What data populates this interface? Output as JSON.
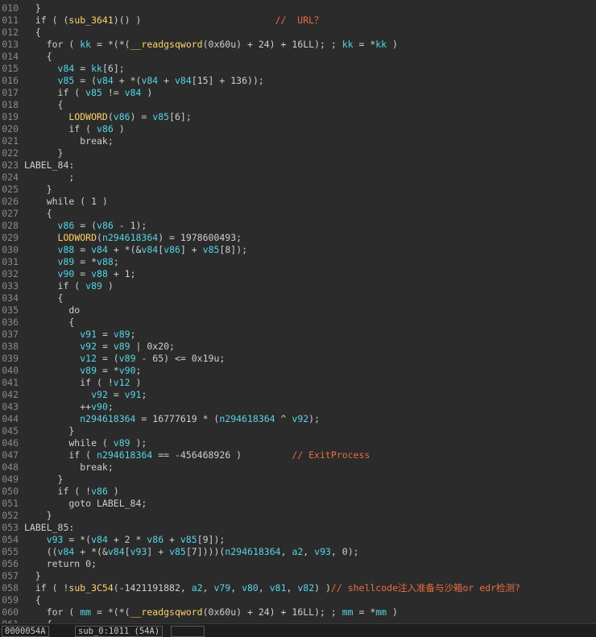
{
  "editor": {
    "lines": [
      {
        "n": "010",
        "tokens": [
          {
            "t": "  }",
            "c": "plain"
          }
        ]
      },
      {
        "n": "011",
        "tokens": [
          {
            "t": "  if ( (",
            "c": "plain"
          },
          {
            "t": "sub_3641",
            "c": "func"
          },
          {
            "t": ")() )                        ",
            "c": "plain"
          },
          {
            "t": "//  URL？",
            "c": "comment"
          }
        ]
      },
      {
        "n": "012",
        "tokens": [
          {
            "t": "  {",
            "c": "plain"
          }
        ]
      },
      {
        "n": "013",
        "tokens": [
          {
            "t": "    for ( ",
            "c": "plain"
          },
          {
            "t": "kk",
            "c": "var"
          },
          {
            "t": " = *(*(",
            "c": "plain"
          },
          {
            "t": "__readgsqword",
            "c": "func"
          },
          {
            "t": "(0x60u) + 24) + 16LL); ; ",
            "c": "plain"
          },
          {
            "t": "kk",
            "c": "var"
          },
          {
            "t": " = *",
            "c": "plain"
          },
          {
            "t": "kk",
            "c": "var"
          },
          {
            "t": " )",
            "c": "plain"
          }
        ]
      },
      {
        "n": "014",
        "tokens": [
          {
            "t": "    {",
            "c": "plain"
          }
        ]
      },
      {
        "n": "015",
        "tokens": [
          {
            "t": "      ",
            "c": "plain"
          },
          {
            "t": "v84",
            "c": "var"
          },
          {
            "t": " = ",
            "c": "plain"
          },
          {
            "t": "kk",
            "c": "var"
          },
          {
            "t": "[6];",
            "c": "plain"
          }
        ]
      },
      {
        "n": "016",
        "tokens": [
          {
            "t": "      ",
            "c": "plain"
          },
          {
            "t": "v85",
            "c": "var"
          },
          {
            "t": " = (",
            "c": "plain"
          },
          {
            "t": "v84",
            "c": "var"
          },
          {
            "t": " + *(",
            "c": "plain"
          },
          {
            "t": "v84",
            "c": "var"
          },
          {
            "t": " + ",
            "c": "plain"
          },
          {
            "t": "v84",
            "c": "var"
          },
          {
            "t": "[15] + 136));",
            "c": "plain"
          }
        ]
      },
      {
        "n": "017",
        "tokens": [
          {
            "t": "      if ( ",
            "c": "plain"
          },
          {
            "t": "v85",
            "c": "var"
          },
          {
            "t": " != ",
            "c": "plain"
          },
          {
            "t": "v84",
            "c": "var"
          },
          {
            "t": " )",
            "c": "plain"
          }
        ]
      },
      {
        "n": "018",
        "tokens": [
          {
            "t": "      {",
            "c": "plain"
          }
        ]
      },
      {
        "n": "019",
        "tokens": [
          {
            "t": "        ",
            "c": "plain"
          },
          {
            "t": "LODWORD",
            "c": "func"
          },
          {
            "t": "(",
            "c": "plain"
          },
          {
            "t": "v86",
            "c": "var"
          },
          {
            "t": ") = ",
            "c": "plain"
          },
          {
            "t": "v85",
            "c": "var"
          },
          {
            "t": "[6];",
            "c": "plain"
          }
        ]
      },
      {
        "n": "020",
        "tokens": [
          {
            "t": "        if ( ",
            "c": "plain"
          },
          {
            "t": "v86",
            "c": "var"
          },
          {
            "t": " )",
            "c": "plain"
          }
        ]
      },
      {
        "n": "021",
        "tokens": [
          {
            "t": "          break;",
            "c": "plain"
          }
        ]
      },
      {
        "n": "022",
        "tokens": [
          {
            "t": "      }",
            "c": "plain"
          }
        ]
      },
      {
        "n": "023",
        "tokens": [
          {
            "t": "LABEL_84:",
            "c": "plain"
          }
        ]
      },
      {
        "n": "024",
        "tokens": [
          {
            "t": "        ;",
            "c": "plain"
          }
        ]
      },
      {
        "n": "025",
        "tokens": [
          {
            "t": "    }",
            "c": "plain"
          }
        ]
      },
      {
        "n": "026",
        "tokens": [
          {
            "t": "    while ( 1 )",
            "c": "plain"
          }
        ]
      },
      {
        "n": "027",
        "tokens": [
          {
            "t": "    {",
            "c": "plain"
          }
        ]
      },
      {
        "n": "028",
        "tokens": [
          {
            "t": "      ",
            "c": "plain"
          },
          {
            "t": "v86",
            "c": "var"
          },
          {
            "t": " = (",
            "c": "plain"
          },
          {
            "t": "v86",
            "c": "var"
          },
          {
            "t": " - 1);",
            "c": "plain"
          }
        ]
      },
      {
        "n": "029",
        "tokens": [
          {
            "t": "      ",
            "c": "plain"
          },
          {
            "t": "LODWORD",
            "c": "func"
          },
          {
            "t": "(",
            "c": "plain"
          },
          {
            "t": "n294618364",
            "c": "var"
          },
          {
            "t": ") = 1978600493;",
            "c": "plain"
          }
        ]
      },
      {
        "n": "030",
        "tokens": [
          {
            "t": "      ",
            "c": "plain"
          },
          {
            "t": "v88",
            "c": "var"
          },
          {
            "t": " = ",
            "c": "plain"
          },
          {
            "t": "v84",
            "c": "var"
          },
          {
            "t": " + *(&",
            "c": "plain"
          },
          {
            "t": "v84",
            "c": "var"
          },
          {
            "t": "[",
            "c": "plain"
          },
          {
            "t": "v86",
            "c": "var"
          },
          {
            "t": "] + ",
            "c": "plain"
          },
          {
            "t": "v85",
            "c": "var"
          },
          {
            "t": "[8]);",
            "c": "plain"
          }
        ]
      },
      {
        "n": "031",
        "tokens": [
          {
            "t": "      ",
            "c": "plain"
          },
          {
            "t": "v89",
            "c": "var"
          },
          {
            "t": " = *",
            "c": "plain"
          },
          {
            "t": "v88",
            "c": "var"
          },
          {
            "t": ";",
            "c": "plain"
          }
        ]
      },
      {
        "n": "032",
        "tokens": [
          {
            "t": "      ",
            "c": "plain"
          },
          {
            "t": "v90",
            "c": "var"
          },
          {
            "t": " = ",
            "c": "plain"
          },
          {
            "t": "v88",
            "c": "var"
          },
          {
            "t": " + 1;",
            "c": "plain"
          }
        ]
      },
      {
        "n": "033",
        "tokens": [
          {
            "t": "      if ( ",
            "c": "plain"
          },
          {
            "t": "v89",
            "c": "var"
          },
          {
            "t": " )",
            "c": "plain"
          }
        ]
      },
      {
        "n": "034",
        "tokens": [
          {
            "t": "      {",
            "c": "plain"
          }
        ]
      },
      {
        "n": "035",
        "tokens": [
          {
            "t": "        do",
            "c": "plain"
          }
        ]
      },
      {
        "n": "036",
        "tokens": [
          {
            "t": "        {",
            "c": "plain"
          }
        ]
      },
      {
        "n": "037",
        "tokens": [
          {
            "t": "          ",
            "c": "plain"
          },
          {
            "t": "v91",
            "c": "var"
          },
          {
            "t": " = ",
            "c": "plain"
          },
          {
            "t": "v89",
            "c": "var"
          },
          {
            "t": ";",
            "c": "plain"
          }
        ]
      },
      {
        "n": "038",
        "tokens": [
          {
            "t": "          ",
            "c": "plain"
          },
          {
            "t": "v92",
            "c": "var"
          },
          {
            "t": " = ",
            "c": "plain"
          },
          {
            "t": "v89",
            "c": "var"
          },
          {
            "t": " | 0x20;",
            "c": "plain"
          }
        ]
      },
      {
        "n": "039",
        "tokens": [
          {
            "t": "          ",
            "c": "plain"
          },
          {
            "t": "v12",
            "c": "var"
          },
          {
            "t": " = (",
            "c": "plain"
          },
          {
            "t": "v89",
            "c": "var"
          },
          {
            "t": " - 65) <= 0x19u;",
            "c": "plain"
          }
        ]
      },
      {
        "n": "040",
        "tokens": [
          {
            "t": "          ",
            "c": "plain"
          },
          {
            "t": "v89",
            "c": "var"
          },
          {
            "t": " = *",
            "c": "plain"
          },
          {
            "t": "v90",
            "c": "var"
          },
          {
            "t": ";",
            "c": "plain"
          }
        ]
      },
      {
        "n": "041",
        "tokens": [
          {
            "t": "          if ( !",
            "c": "plain"
          },
          {
            "t": "v12",
            "c": "var"
          },
          {
            "t": " )",
            "c": "plain"
          }
        ]
      },
      {
        "n": "042",
        "tokens": [
          {
            "t": "            ",
            "c": "plain"
          },
          {
            "t": "v92",
            "c": "var"
          },
          {
            "t": " = ",
            "c": "plain"
          },
          {
            "t": "v91",
            "c": "var"
          },
          {
            "t": ";",
            "c": "plain"
          }
        ]
      },
      {
        "n": "043",
        "tokens": [
          {
            "t": "          ++",
            "c": "plain"
          },
          {
            "t": "v90",
            "c": "var"
          },
          {
            "t": ";",
            "c": "plain"
          }
        ]
      },
      {
        "n": "044",
        "tokens": [
          {
            "t": "          ",
            "c": "plain"
          },
          {
            "t": "n294618364",
            "c": "var"
          },
          {
            "t": " = 16777619 * (",
            "c": "plain"
          },
          {
            "t": "n294618364",
            "c": "var"
          },
          {
            "t": " ^ ",
            "c": "plain"
          },
          {
            "t": "v92",
            "c": "var"
          },
          {
            "t": ");",
            "c": "plain"
          }
        ]
      },
      {
        "n": "045",
        "tokens": [
          {
            "t": "        }",
            "c": "plain"
          }
        ]
      },
      {
        "n": "046",
        "tokens": [
          {
            "t": "        while ( ",
            "c": "plain"
          },
          {
            "t": "v89",
            "c": "var"
          },
          {
            "t": " );",
            "c": "plain"
          }
        ]
      },
      {
        "n": "047",
        "tokens": [
          {
            "t": "        if ( ",
            "c": "plain"
          },
          {
            "t": "n294618364",
            "c": "var"
          },
          {
            "t": " == -456468926 )         ",
            "c": "plain"
          },
          {
            "t": "// ExitProcess",
            "c": "comment"
          }
        ]
      },
      {
        "n": "048",
        "tokens": [
          {
            "t": "          break;",
            "c": "plain"
          }
        ]
      },
      {
        "n": "049",
        "tokens": [
          {
            "t": "      }",
            "c": "plain"
          }
        ]
      },
      {
        "n": "050",
        "tokens": [
          {
            "t": "      if ( !",
            "c": "plain"
          },
          {
            "t": "v86",
            "c": "var"
          },
          {
            "t": " )",
            "c": "plain"
          }
        ]
      },
      {
        "n": "051",
        "tokens": [
          {
            "t": "        goto LABEL_84;",
            "c": "plain"
          }
        ]
      },
      {
        "n": "052",
        "tokens": [
          {
            "t": "    }",
            "c": "plain"
          }
        ]
      },
      {
        "n": "053",
        "tokens": [
          {
            "t": "LABEL_85:",
            "c": "plain"
          }
        ]
      },
      {
        "n": "054",
        "tokens": [
          {
            "t": "    ",
            "c": "plain"
          },
          {
            "t": "v93",
            "c": "var"
          },
          {
            "t": " = *(",
            "c": "plain"
          },
          {
            "t": "v84",
            "c": "var"
          },
          {
            "t": " + 2 * ",
            "c": "plain"
          },
          {
            "t": "v86",
            "c": "var"
          },
          {
            "t": " + ",
            "c": "plain"
          },
          {
            "t": "v85",
            "c": "var"
          },
          {
            "t": "[9]);",
            "c": "plain"
          }
        ]
      },
      {
        "n": "055",
        "tokens": [
          {
            "t": "    ((",
            "c": "plain"
          },
          {
            "t": "v84",
            "c": "var"
          },
          {
            "t": " + *(&",
            "c": "plain"
          },
          {
            "t": "v84",
            "c": "var"
          },
          {
            "t": "[",
            "c": "plain"
          },
          {
            "t": "v93",
            "c": "var"
          },
          {
            "t": "] + ",
            "c": "plain"
          },
          {
            "t": "v85",
            "c": "var"
          },
          {
            "t": "[7])))(",
            "c": "plain"
          },
          {
            "t": "n294618364",
            "c": "var"
          },
          {
            "t": ", ",
            "c": "plain"
          },
          {
            "t": "a2",
            "c": "var"
          },
          {
            "t": ", ",
            "c": "plain"
          },
          {
            "t": "v93",
            "c": "var"
          },
          {
            "t": ", 0);",
            "c": "plain"
          }
        ]
      },
      {
        "n": "056",
        "tokens": [
          {
            "t": "    return 0;",
            "c": "plain"
          }
        ]
      },
      {
        "n": "057",
        "tokens": [
          {
            "t": "  }",
            "c": "plain"
          }
        ]
      },
      {
        "n": "058",
        "tokens": [
          {
            "t": "  if ( !",
            "c": "plain"
          },
          {
            "t": "sub_3C54",
            "c": "func"
          },
          {
            "t": "(-1421191882, ",
            "c": "plain"
          },
          {
            "t": "a2",
            "c": "var"
          },
          {
            "t": ", ",
            "c": "plain"
          },
          {
            "t": "v79",
            "c": "var"
          },
          {
            "t": ", ",
            "c": "plain"
          },
          {
            "t": "v80",
            "c": "var"
          },
          {
            "t": ", ",
            "c": "plain"
          },
          {
            "t": "v81",
            "c": "var"
          },
          {
            "t": ", ",
            "c": "plain"
          },
          {
            "t": "v82",
            "c": "var"
          },
          {
            "t": ") )",
            "c": "plain"
          },
          {
            "t": "// shellcode注入准备与沙箱or edr检测?",
            "c": "comment"
          }
        ]
      },
      {
        "n": "059",
        "tokens": [
          {
            "t": "  {",
            "c": "plain"
          }
        ]
      },
      {
        "n": "060",
        "tokens": [
          {
            "t": "    for ( ",
            "c": "plain"
          },
          {
            "t": "mm",
            "c": "var"
          },
          {
            "t": " = *(*(",
            "c": "plain"
          },
          {
            "t": "__readgsqword",
            "c": "func"
          },
          {
            "t": "(0x60u) + 24) + 16LL); ; ",
            "c": "plain"
          },
          {
            "t": "mm",
            "c": "var"
          },
          {
            "t": " = *",
            "c": "plain"
          },
          {
            "t": "mm",
            "c": "var"
          },
          {
            "t": " )",
            "c": "plain"
          }
        ]
      },
      {
        "n": "061",
        "tokens": [
          {
            "t": "    {",
            "c": "plain"
          }
        ]
      }
    ]
  },
  "statusbar": {
    "address": "0000054A",
    "location": "sub_0:1011 (54A)",
    "extra": ""
  },
  "colors": {
    "background": "#2b2b2b",
    "variable": "#54d6e6",
    "function": "#ffd36a",
    "comment": "#ea6d3f",
    "line_number": "#8a8a8a",
    "plain": "#cfcfcf"
  }
}
